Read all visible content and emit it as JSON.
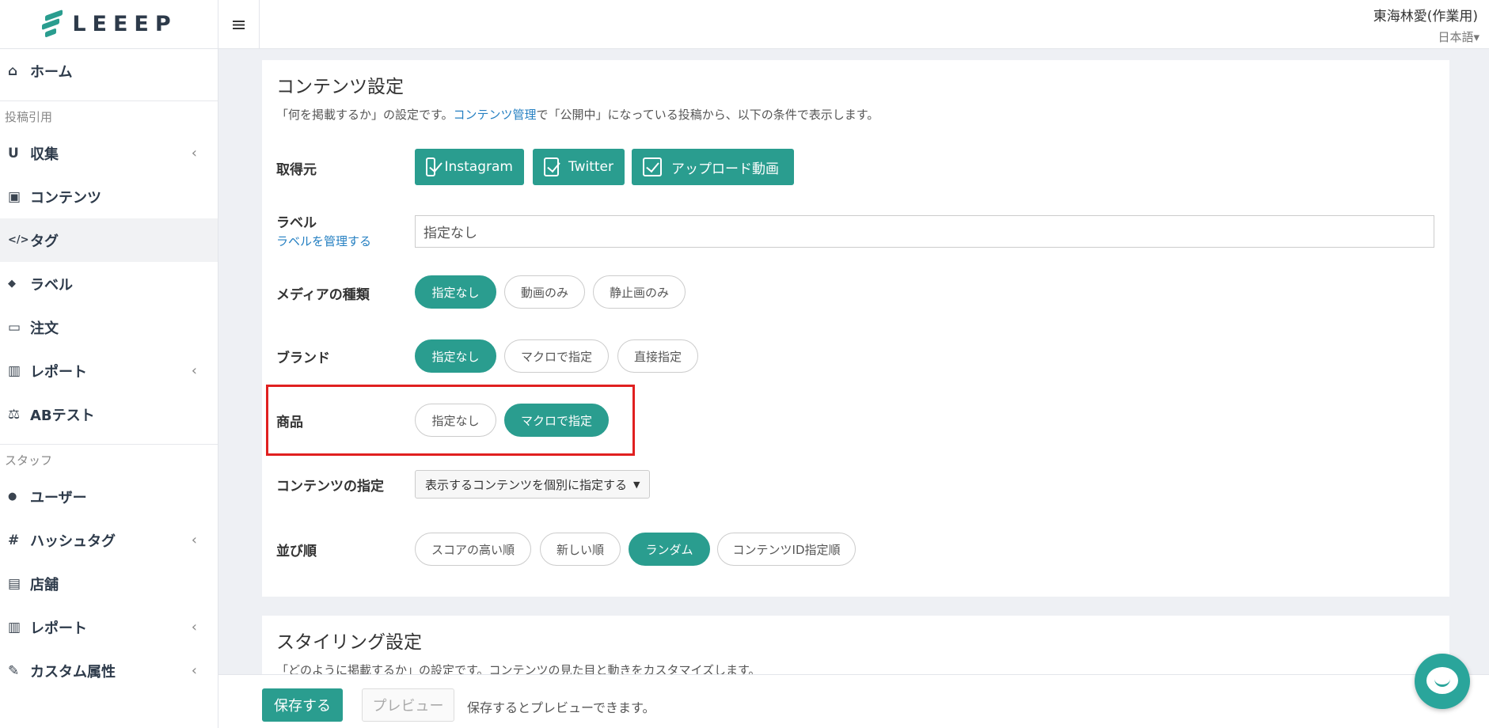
{
  "logo": {
    "text": "LEEEP",
    "color": "#2a9d8f"
  },
  "header": {
    "menu_icon": "hamburger-icon",
    "user_name": "東海林愛(作業用)",
    "language": "日本語▾"
  },
  "sidebar": {
    "items": [
      {
        "icon": "home-icon",
        "glyph": "⌂",
        "label": "ホーム"
      },
      {
        "section": "投稿引用"
      },
      {
        "icon": "magnet-icon",
        "glyph": "U",
        "label": "収集",
        "chevron": "‹"
      },
      {
        "icon": "image-icon",
        "glyph": "▣",
        "label": "コンテンツ"
      },
      {
        "icon": "code-icon",
        "glyph": "</>",
        "label": "タグ",
        "active": true
      },
      {
        "icon": "tag-icon",
        "glyph": "◆",
        "label": "ラベル"
      },
      {
        "icon": "cart-icon",
        "glyph": "▭",
        "label": "注文"
      },
      {
        "icon": "bar-chart-icon",
        "glyph": "▥",
        "label": "レポート",
        "chevron": "‹"
      },
      {
        "icon": "scale-icon",
        "glyph": "⚖",
        "label": "ABテスト"
      },
      {
        "section": "スタッフ"
      },
      {
        "icon": "users-icon",
        "glyph": "●",
        "label": "ユーザー"
      },
      {
        "icon": "hashtag-icon",
        "glyph": "#",
        "label": "ハッシュタグ",
        "chevron": "‹"
      },
      {
        "icon": "building-icon",
        "glyph": "▤",
        "label": "店舗"
      },
      {
        "icon": "bar-chart-icon",
        "glyph": "▥",
        "label": "レポート",
        "chevron": "‹"
      },
      {
        "icon": "wrench-icon",
        "glyph": "✎",
        "label": "カスタム属性",
        "chevron": "‹"
      }
    ]
  },
  "content_settings": {
    "title": "コンテンツ設定",
    "desc_pre": "「何を掲載するか」の設定です。",
    "desc_link": "コンテンツ管理",
    "desc_post": "で「公開中」になっている投稿から、以下の条件で表示します。",
    "source": {
      "label": "取得元",
      "options": [
        "Instagram",
        "Twitter",
        "アップロード動画"
      ]
    },
    "label_row": {
      "label": "ラベル",
      "manage_link": "ラベルを管理する",
      "input_value": "指定なし"
    },
    "media_type": {
      "label": "メディアの種類",
      "options": [
        "指定なし",
        "動画のみ",
        "静止画のみ"
      ],
      "selected": "指定なし"
    },
    "brand": {
      "label": "ブランド",
      "options": [
        "指定なし",
        "マクロで指定",
        "直接指定"
      ],
      "selected": "指定なし"
    },
    "product": {
      "label": "商品",
      "options": [
        "指定なし",
        "マクロで指定"
      ],
      "selected": "マクロで指定"
    },
    "content_spec": {
      "label": "コンテンツの指定",
      "dropdown": "表示するコンテンツを個別に指定する"
    },
    "sort": {
      "label": "並び順",
      "options": [
        "スコアの高い順",
        "新しい順",
        "ランダム",
        "コンテンツID指定順"
      ],
      "selected": "ランダム"
    }
  },
  "styling_settings": {
    "title": "スタイリング設定",
    "desc": "「どのように掲載するか」の設定です。コンテンツの見た目と動きをカスタマイズします。"
  },
  "footer": {
    "save": "保存する",
    "preview": "プレビュー",
    "note": "保存するとプレビューできます。"
  },
  "colors": {
    "accent": "#2a9d8f",
    "highlight": "#e02020",
    "link": "#2680c2"
  }
}
